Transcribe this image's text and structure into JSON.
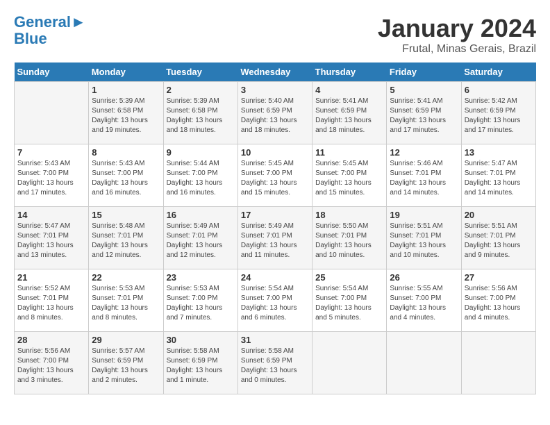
{
  "header": {
    "logo_line1": "General",
    "logo_line2": "Blue",
    "month": "January 2024",
    "location": "Frutal, Minas Gerais, Brazil"
  },
  "days_of_week": [
    "Sunday",
    "Monday",
    "Tuesday",
    "Wednesday",
    "Thursday",
    "Friday",
    "Saturday"
  ],
  "weeks": [
    [
      {
        "day": "",
        "info": ""
      },
      {
        "day": "1",
        "info": "Sunrise: 5:39 AM\nSunset: 6:58 PM\nDaylight: 13 hours\nand 19 minutes."
      },
      {
        "day": "2",
        "info": "Sunrise: 5:39 AM\nSunset: 6:58 PM\nDaylight: 13 hours\nand 18 minutes."
      },
      {
        "day": "3",
        "info": "Sunrise: 5:40 AM\nSunset: 6:59 PM\nDaylight: 13 hours\nand 18 minutes."
      },
      {
        "day": "4",
        "info": "Sunrise: 5:41 AM\nSunset: 6:59 PM\nDaylight: 13 hours\nand 18 minutes."
      },
      {
        "day": "5",
        "info": "Sunrise: 5:41 AM\nSunset: 6:59 PM\nDaylight: 13 hours\nand 17 minutes."
      },
      {
        "day": "6",
        "info": "Sunrise: 5:42 AM\nSunset: 6:59 PM\nDaylight: 13 hours\nand 17 minutes."
      }
    ],
    [
      {
        "day": "7",
        "info": "Sunrise: 5:43 AM\nSunset: 7:00 PM\nDaylight: 13 hours\nand 17 minutes."
      },
      {
        "day": "8",
        "info": "Sunrise: 5:43 AM\nSunset: 7:00 PM\nDaylight: 13 hours\nand 16 minutes."
      },
      {
        "day": "9",
        "info": "Sunrise: 5:44 AM\nSunset: 7:00 PM\nDaylight: 13 hours\nand 16 minutes."
      },
      {
        "day": "10",
        "info": "Sunrise: 5:45 AM\nSunset: 7:00 PM\nDaylight: 13 hours\nand 15 minutes."
      },
      {
        "day": "11",
        "info": "Sunrise: 5:45 AM\nSunset: 7:00 PM\nDaylight: 13 hours\nand 15 minutes."
      },
      {
        "day": "12",
        "info": "Sunrise: 5:46 AM\nSunset: 7:01 PM\nDaylight: 13 hours\nand 14 minutes."
      },
      {
        "day": "13",
        "info": "Sunrise: 5:47 AM\nSunset: 7:01 PM\nDaylight: 13 hours\nand 14 minutes."
      }
    ],
    [
      {
        "day": "14",
        "info": "Sunrise: 5:47 AM\nSunset: 7:01 PM\nDaylight: 13 hours\nand 13 minutes."
      },
      {
        "day": "15",
        "info": "Sunrise: 5:48 AM\nSunset: 7:01 PM\nDaylight: 13 hours\nand 12 minutes."
      },
      {
        "day": "16",
        "info": "Sunrise: 5:49 AM\nSunset: 7:01 PM\nDaylight: 13 hours\nand 12 minutes."
      },
      {
        "day": "17",
        "info": "Sunrise: 5:49 AM\nSunset: 7:01 PM\nDaylight: 13 hours\nand 11 minutes."
      },
      {
        "day": "18",
        "info": "Sunrise: 5:50 AM\nSunset: 7:01 PM\nDaylight: 13 hours\nand 10 minutes."
      },
      {
        "day": "19",
        "info": "Sunrise: 5:51 AM\nSunset: 7:01 PM\nDaylight: 13 hours\nand 10 minutes."
      },
      {
        "day": "20",
        "info": "Sunrise: 5:51 AM\nSunset: 7:01 PM\nDaylight: 13 hours\nand 9 minutes."
      }
    ],
    [
      {
        "day": "21",
        "info": "Sunrise: 5:52 AM\nSunset: 7:01 PM\nDaylight: 13 hours\nand 8 minutes."
      },
      {
        "day": "22",
        "info": "Sunrise: 5:53 AM\nSunset: 7:01 PM\nDaylight: 13 hours\nand 8 minutes."
      },
      {
        "day": "23",
        "info": "Sunrise: 5:53 AM\nSunset: 7:00 PM\nDaylight: 13 hours\nand 7 minutes."
      },
      {
        "day": "24",
        "info": "Sunrise: 5:54 AM\nSunset: 7:00 PM\nDaylight: 13 hours\nand 6 minutes."
      },
      {
        "day": "25",
        "info": "Sunrise: 5:54 AM\nSunset: 7:00 PM\nDaylight: 13 hours\nand 5 minutes."
      },
      {
        "day": "26",
        "info": "Sunrise: 5:55 AM\nSunset: 7:00 PM\nDaylight: 13 hours\nand 4 minutes."
      },
      {
        "day": "27",
        "info": "Sunrise: 5:56 AM\nSunset: 7:00 PM\nDaylight: 13 hours\nand 4 minutes."
      }
    ],
    [
      {
        "day": "28",
        "info": "Sunrise: 5:56 AM\nSunset: 7:00 PM\nDaylight: 13 hours\nand 3 minutes."
      },
      {
        "day": "29",
        "info": "Sunrise: 5:57 AM\nSunset: 6:59 PM\nDaylight: 13 hours\nand 2 minutes."
      },
      {
        "day": "30",
        "info": "Sunrise: 5:58 AM\nSunset: 6:59 PM\nDaylight: 13 hours\nand 1 minute."
      },
      {
        "day": "31",
        "info": "Sunrise: 5:58 AM\nSunset: 6:59 PM\nDaylight: 13 hours\nand 0 minutes."
      },
      {
        "day": "",
        "info": ""
      },
      {
        "day": "",
        "info": ""
      },
      {
        "day": "",
        "info": ""
      }
    ]
  ]
}
